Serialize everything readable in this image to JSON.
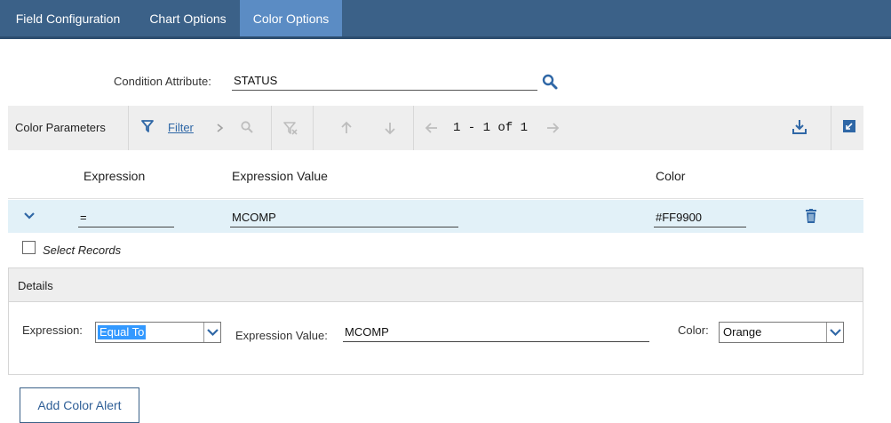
{
  "tabs": [
    {
      "label": "Field Configuration"
    },
    {
      "label": "Chart Options"
    },
    {
      "label": "Color Options"
    }
  ],
  "condition": {
    "label": "Condition Attribute:",
    "value": "STATUS"
  },
  "toolbar": {
    "title": "Color Parameters",
    "filter_label": "Filter",
    "pager_text": "1 - 1 of 1"
  },
  "table": {
    "headers": [
      "Expression",
      "Expression Value",
      "Color"
    ],
    "rows": [
      {
        "expression": "=",
        "expression_value": "MCOMP",
        "color": "#FF9900"
      }
    ]
  },
  "select_records_label": "Select Records",
  "details": {
    "title": "Details",
    "expression_label": "Expression:",
    "expression_selected": "Equal To",
    "expression_value_label": "Expression Value:",
    "expression_value": "MCOMP",
    "color_label": "Color:",
    "color_selected": "Orange"
  },
  "add_button_label": "Add Color Alert",
  "colors": {
    "tab_bar": "#3b6188",
    "tab_active": "#5b8cc4",
    "row_selected": "#e2f1f8",
    "link": "#2f67a6",
    "icon_blue": "#2f67a6"
  }
}
